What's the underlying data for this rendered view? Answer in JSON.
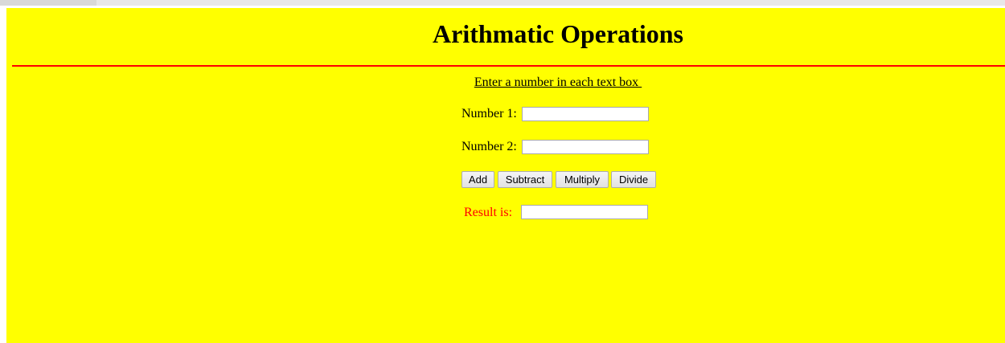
{
  "header": {
    "title": "Arithmatic Operations"
  },
  "form": {
    "instruction": "Enter a number in each text box ",
    "number1": {
      "label": "Number 1:",
      "value": ""
    },
    "number2": {
      "label": "Number 2:",
      "value": ""
    },
    "buttons": {
      "add": "Add",
      "subtract": "Subtract",
      "multiply": "Multiply",
      "divide": "Divide"
    },
    "result": {
      "label": "Result is:",
      "value": ""
    }
  },
  "colors": {
    "page_background": "#ffff00",
    "rule": "#ff0000",
    "result_label": "#ff0000"
  }
}
